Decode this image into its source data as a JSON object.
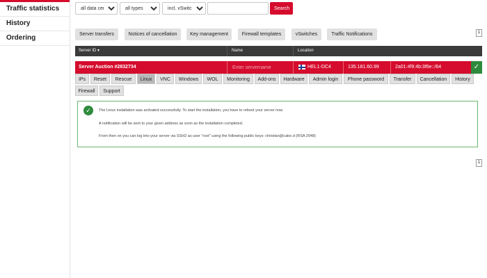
{
  "sidebar": {
    "items": [
      {
        "label": "Traffic statistics"
      },
      {
        "label": "History"
      },
      {
        "label": "Ordering"
      }
    ]
  },
  "filters": {
    "datacentre": "all data centres",
    "type": "all types",
    "vswitch": "incl. vSwitch",
    "search_value": "",
    "search_button": "Search"
  },
  "actions": {
    "buttons": [
      {
        "label": "Server transfers"
      },
      {
        "label": "Notices of cancellation"
      },
      {
        "label": "Key management"
      },
      {
        "label": "Firewall templates"
      },
      {
        "label": "vSwitches"
      },
      {
        "label": "Traffic Notifications"
      }
    ]
  },
  "pagination": {
    "page": "1"
  },
  "table": {
    "headers": {
      "server_id": "Server ID ▾",
      "name": "Name",
      "location": "Location"
    }
  },
  "server": {
    "title": "Server Auction #2832734",
    "name_placeholder": "Enter servername",
    "location": "HEL1-DC4",
    "ipv4": "135.181.60.99",
    "ipv6": "2a01:4f9:4b:3f6e::/64",
    "status_icon": "check-icon"
  },
  "tabs": [
    {
      "label": "IPs"
    },
    {
      "label": "Reset"
    },
    {
      "label": "Rescue"
    },
    {
      "label": "Linux"
    },
    {
      "label": "VNC"
    },
    {
      "label": "Windows"
    },
    {
      "label": "WOL"
    },
    {
      "label": "Monitoring"
    },
    {
      "label": "Add-ons"
    },
    {
      "label": "Hardware"
    },
    {
      "label": "Admin login"
    },
    {
      "label": "Phone password"
    },
    {
      "label": "Transfer"
    },
    {
      "label": "Cancellation"
    },
    {
      "label": "History"
    },
    {
      "label": "Firewall"
    },
    {
      "label": "Support"
    }
  ],
  "active_tab": "Linux",
  "message": {
    "line1": "The Linux installation was activated successfully. To start the installation, you have to reboot your server now.",
    "line2": "A notification will be sent to your given address as soon as the installation completed.",
    "line3": "From then on you can log into your server via SSH2 as user \"root\" using the following public keys: christian@cabo.d (RSA 2048)"
  },
  "colors": {
    "accent": "#d50c2d",
    "success": "#2e8b3d",
    "header_bg": "#3a3a3a"
  }
}
